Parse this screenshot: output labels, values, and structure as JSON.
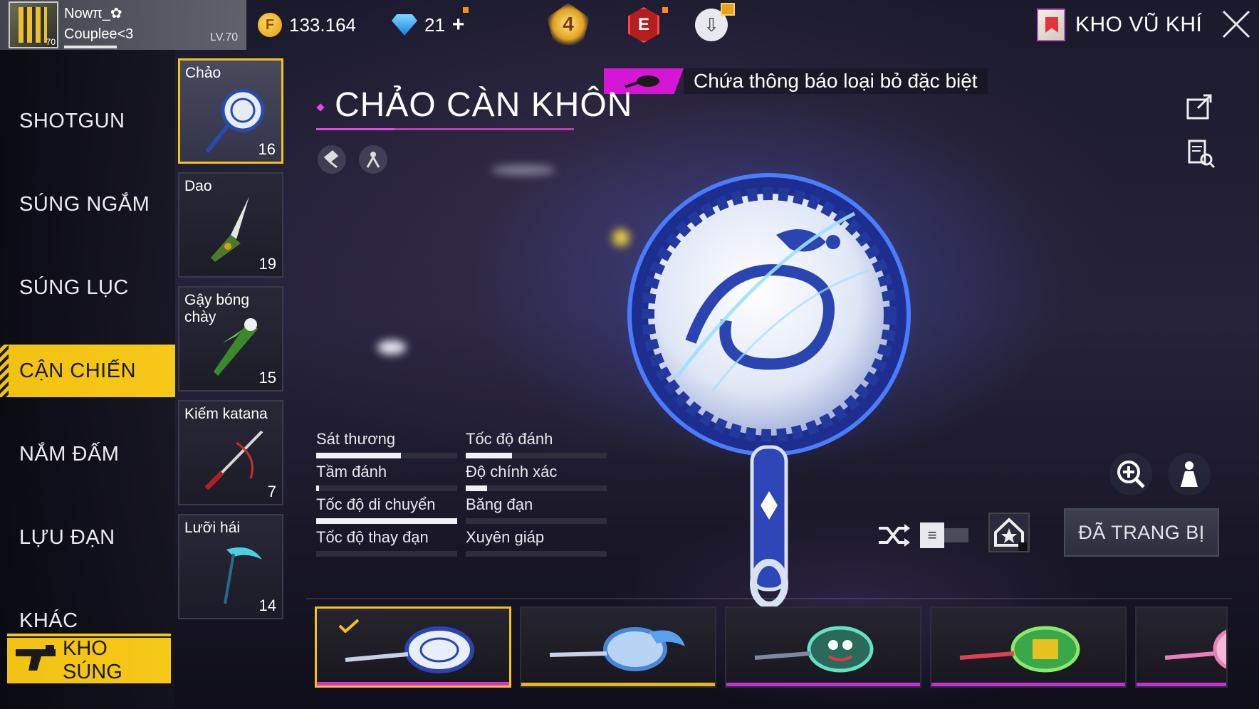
{
  "profile": {
    "name": "Nowπ_✿",
    "clan": "Couplee<3",
    "level": "LV.70",
    "avatar_level": "70"
  },
  "currency": {
    "gold": "133.164",
    "diamonds": "21",
    "diamond_plus": "+"
  },
  "header_icons": {
    "rank_badge": "4",
    "elite_badge": "E"
  },
  "arsenal": {
    "label": "KHO VŨ KHÍ"
  },
  "nav": {
    "items": [
      "SHOTGUN",
      "SÚNG NGẮM",
      "SÚNG LỤC",
      "CẬN CHIẾN",
      "NẮM ĐẤM",
      "LỰU ĐẠN",
      "KHÁC"
    ],
    "active": "CẬN CHIẾN",
    "bottom_button": "KHO SÚNG"
  },
  "weapons": [
    {
      "name": "Chảo",
      "count": "16",
      "icon": "pan-icon",
      "selected": true
    },
    {
      "name": "Dao",
      "count": "19",
      "icon": "dagger-icon",
      "selected": false
    },
    {
      "name": "Gậy bóng chày",
      "count": "15",
      "icon": "bat-icon",
      "selected": false
    },
    {
      "name": "Kiếm katana",
      "count": "7",
      "icon": "katana-icon",
      "selected": false
    },
    {
      "name": "Lưỡi hái",
      "count": "14",
      "icon": "scythe-icon",
      "selected": false
    }
  ],
  "item": {
    "title": "CHẢO CÀN KHÔN",
    "notice": "Chứa thông báo loại bỏ đặc biệt"
  },
  "stats": [
    {
      "label": "Sát thương",
      "value": 0.6
    },
    {
      "label": "Tốc độ đánh",
      "value": 0.33
    },
    {
      "label": "Tầm đánh",
      "value": 0.02
    },
    {
      "label": "Độ chính xác",
      "value": 0.15
    },
    {
      "label": "Tốc độ di chuyển",
      "value": 1.0
    },
    {
      "label": "Băng đạn",
      "value": 0.0
    },
    {
      "label": "Tốc độ thay đạn",
      "value": 0.0
    },
    {
      "label": "Xuyên giáp",
      "value": 0.0
    }
  ],
  "controls": {
    "equipped_label": "ĐÃ TRANG BỊ",
    "toggle_glyph": "≡"
  },
  "skins": [
    {
      "name": "blue-dragon-pan",
      "rarity_color": "#d631d6",
      "selected": true
    },
    {
      "name": "blue-wave-pan",
      "rarity_color": "#e8b521",
      "selected": false
    },
    {
      "name": "face-pan",
      "rarity_color": "#c330d6",
      "selected": false
    },
    {
      "name": "green-gold-pan",
      "rarity_color": "#c330d6",
      "selected": false
    },
    {
      "name": "pink-pan",
      "rarity_color": "#c330d6",
      "selected": false
    }
  ],
  "colors": {
    "accent_yellow": "#f4c21a",
    "accent_magenta": "#d616d6"
  }
}
